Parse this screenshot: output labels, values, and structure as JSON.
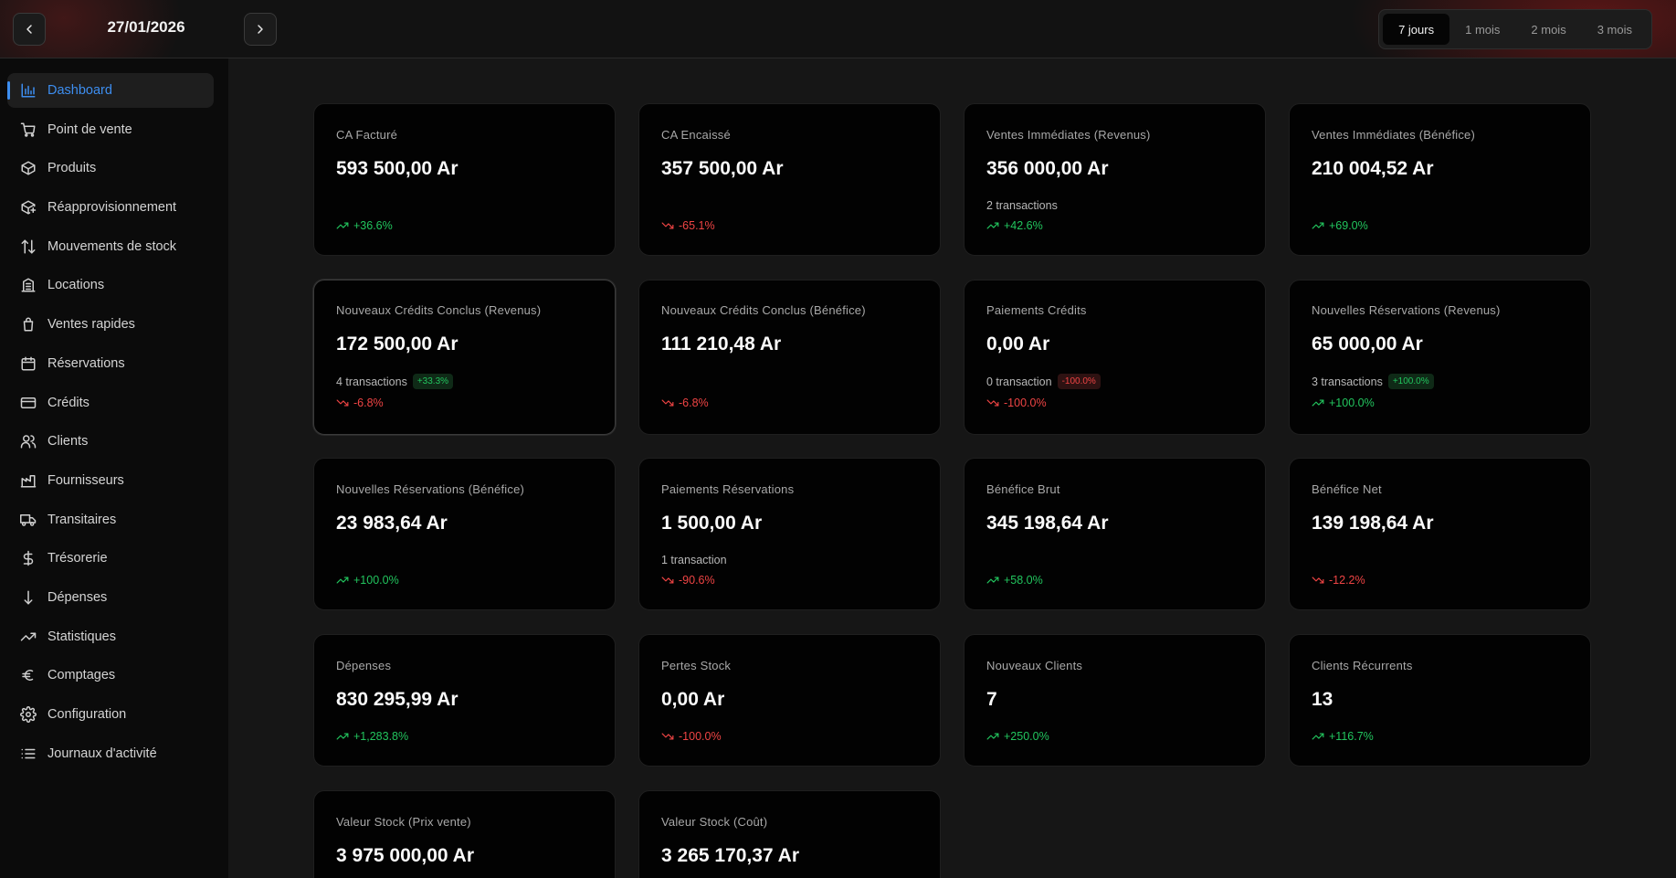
{
  "header": {
    "date": "27/01/2026",
    "ranges": [
      "7 jours",
      "1 mois",
      "2 mois",
      "3 mois"
    ],
    "active_range": "7 jours"
  },
  "sidebar": {
    "items": [
      {
        "label": "Dashboard",
        "icon": "bar-chart-icon",
        "active": true
      },
      {
        "label": "Point de vente",
        "icon": "cart-icon"
      },
      {
        "label": "Produits",
        "icon": "box-icon"
      },
      {
        "label": "Réapprovisionnement",
        "icon": "package-plus-icon"
      },
      {
        "label": "Mouvements de stock",
        "icon": "arrows-up-down-icon"
      },
      {
        "label": "Locations",
        "icon": "building-icon"
      },
      {
        "label": "Ventes rapides",
        "icon": "shopping-bag-icon"
      },
      {
        "label": "Réservations",
        "icon": "calendar-icon"
      },
      {
        "label": "Crédits",
        "icon": "credit-card-icon"
      },
      {
        "label": "Clients",
        "icon": "users-icon"
      },
      {
        "label": "Fournisseurs",
        "icon": "factory-icon"
      },
      {
        "label": "Transitaires",
        "icon": "truck-icon"
      },
      {
        "label": "Trésorerie",
        "icon": "dollar-icon"
      },
      {
        "label": "Dépenses",
        "icon": "arrow-down-icon"
      },
      {
        "label": "Statistiques",
        "icon": "trending-up-icon"
      },
      {
        "label": "Comptages",
        "icon": "euro-icon"
      },
      {
        "label": "Configuration",
        "icon": "gear-icon"
      },
      {
        "label": "Journaux d'activité",
        "icon": "list-icon"
      }
    ]
  },
  "cards": [
    {
      "label": "CA Facturé",
      "value": "593 500,00 Ar",
      "trend": "+36.6%",
      "dir": "up"
    },
    {
      "label": "CA Encaissé",
      "value": "357 500,00 Ar",
      "trend": "-65.1%",
      "dir": "down"
    },
    {
      "label": "Ventes Immédiates (Revenus)",
      "value": "356 000,00 Ar",
      "sub": "2 transactions",
      "trend": "+42.6%",
      "dir": "up"
    },
    {
      "label": "Ventes Immédiates (Bénéfice)",
      "value": "210 004,52 Ar",
      "trend": "+69.0%",
      "dir": "up"
    },
    {
      "label": "Nouveaux Crédits Conclus (Revenus)",
      "value": "172 500,00 Ar",
      "sub": "4 transactions",
      "badge": "+33.3%",
      "badge_dir": "up",
      "trend": "-6.8%",
      "dir": "down"
    },
    {
      "label": "Nouveaux Crédits Conclus (Bénéfice)",
      "value": "111 210,48 Ar",
      "trend": "-6.8%",
      "dir": "down"
    },
    {
      "label": "Paiements Crédits",
      "value": "0,00 Ar",
      "sub": "0 transaction",
      "badge": "-100.0%",
      "badge_dir": "down",
      "trend": "-100.0%",
      "dir": "down"
    },
    {
      "label": "Nouvelles Réservations (Revenus)",
      "value": "65 000,00 Ar",
      "sub": "3 transactions",
      "badge": "+100.0%",
      "badge_dir": "up",
      "trend": "+100.0%",
      "dir": "up"
    },
    {
      "label": "Nouvelles Réservations (Bénéfice)",
      "value": "23 983,64 Ar",
      "trend": "+100.0%",
      "dir": "up"
    },
    {
      "label": "Paiements Réservations",
      "value": "1 500,00 Ar",
      "sub": "1 transaction",
      "trend": "-90.6%",
      "dir": "down"
    },
    {
      "label": "Bénéfice Brut",
      "value": "345 198,64 Ar",
      "trend": "+58.0%",
      "dir": "up"
    },
    {
      "label": "Bénéfice Net",
      "value": "139 198,64 Ar",
      "trend": "-12.2%",
      "dir": "down"
    },
    {
      "label": "Dépenses",
      "value": "830 295,99 Ar",
      "trend": "+1,283.8%",
      "dir": "up"
    },
    {
      "label": "Pertes Stock",
      "value": "0,00 Ar",
      "trend": "-100.0%",
      "dir": "down"
    },
    {
      "label": "Nouveaux Clients",
      "value": "7",
      "trend": "+250.0%",
      "dir": "up"
    },
    {
      "label": "Clients Récurrents",
      "value": "13",
      "trend": "+116.7%",
      "dir": "up"
    },
    {
      "label": "Valeur Stock (Prix vente)",
      "value": "3 975 000,00 Ar"
    },
    {
      "label": "Valeur Stock (Coût)",
      "value": "3 265 170,37 Ar"
    }
  ],
  "colors": {
    "accent": "#3d8ef0",
    "up": "#22c55e",
    "down": "#ef4444"
  }
}
